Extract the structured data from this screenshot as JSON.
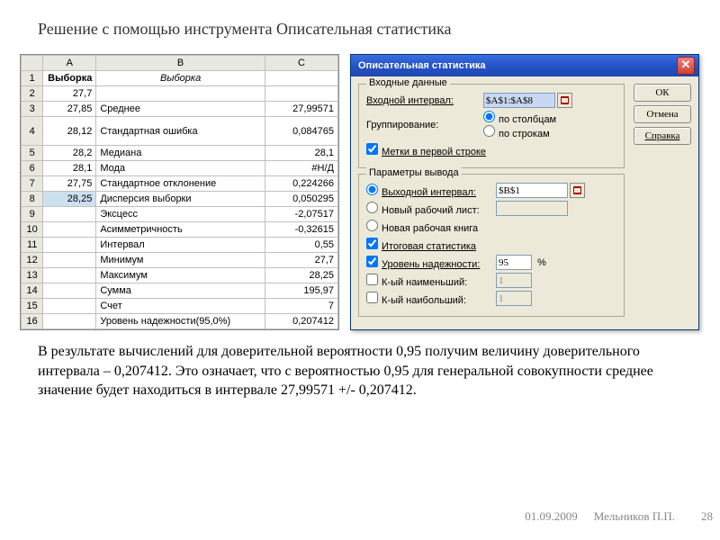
{
  "title": "Решение с помощью инструмента Описательная статистика",
  "spreadsheet": {
    "columns": [
      "",
      "A",
      "B",
      "C"
    ],
    "rows": [
      {
        "n": "1",
        "a": "Выборка",
        "b": "Выборка",
        "c": "",
        "bold_a": true,
        "italic_b": true
      },
      {
        "n": "2",
        "a": "27,7",
        "b": "",
        "c": ""
      },
      {
        "n": "3",
        "a": "27,85",
        "b": "Среднее",
        "c": "27,99571"
      },
      {
        "n": "4",
        "a": "28,12",
        "b": "Стандартная ошибка",
        "c": "0,084765"
      },
      {
        "n": "5",
        "a": "28,2",
        "b": "Медиана",
        "c": "28,1"
      },
      {
        "n": "6",
        "a": "28,1",
        "b": "Мода",
        "c": "#Н/Д"
      },
      {
        "n": "7",
        "a": "27,75",
        "b": "Стандартное отклонение",
        "c": "0,224266"
      },
      {
        "n": "8",
        "a": "28,25",
        "b": "Дисперсия выборки",
        "c": "0,050295",
        "sel": true
      },
      {
        "n": "9",
        "a": "",
        "b": "Эксцесс",
        "c": "-2,07517"
      },
      {
        "n": "10",
        "a": "",
        "b": "Асимметричность",
        "c": "-0,32615"
      },
      {
        "n": "11",
        "a": "",
        "b": "Интервал",
        "c": "0,55"
      },
      {
        "n": "12",
        "a": "",
        "b": "Минимум",
        "c": "27,7"
      },
      {
        "n": "13",
        "a": "",
        "b": "Максимум",
        "c": "28,25"
      },
      {
        "n": "14",
        "a": "",
        "b": "Сумма",
        "c": "195,97"
      },
      {
        "n": "15",
        "a": "",
        "b": "Счет",
        "c": "7"
      },
      {
        "n": "16",
        "a": "",
        "b": "Уровень надежности(95,0%)",
        "c": "0,207412"
      }
    ]
  },
  "dialog": {
    "title": "Описательная статистика",
    "buttons": {
      "ok": "ОК",
      "cancel": "Отмена",
      "help": "Справка"
    },
    "group1": {
      "title": "Входные данные",
      "input_range_lbl": "Входной интервал:",
      "input_range_val": "$A$1:$A$8",
      "grouping_lbl": "Группирование:",
      "by_cols": "по столбцам",
      "by_rows": "по строкам",
      "labels_first": "Метки в первой строке"
    },
    "group2": {
      "title": "Параметры вывода",
      "out_range": "Выходной интервал:",
      "out_range_val": "$B$1",
      "new_ws": "Новый рабочий лист:",
      "new_wb": "Новая рабочая книга",
      "summary": "Итоговая статистика",
      "confidence": "Уровень надежности:",
      "confidence_val": "95",
      "percent": "%",
      "kth_small": "К-ый наименьший:",
      "kth_large": "К-ый наибольший:",
      "kth_val": "1"
    }
  },
  "description": "В результате вычислений для доверительной вероятности 0,95 получим величину доверительного интервала – 0,207412. Это означает, что с вероятностью 0,95 для генеральной совокупности среднее значение будет находиться в интервале 27,99571 +/- 0,207412.",
  "footer": {
    "date": "01.09.2009",
    "author": "Мельников П.П."
  },
  "page": "28"
}
